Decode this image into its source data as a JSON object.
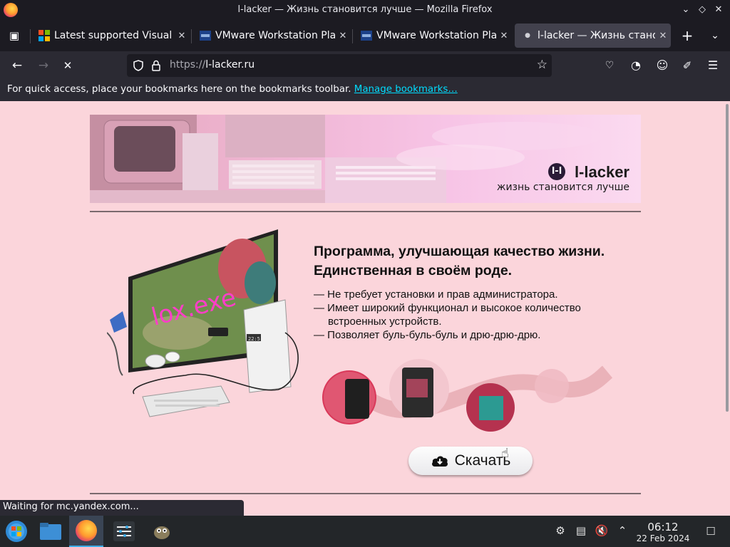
{
  "window": {
    "title": "l-lacker — Жизнь становится лучше — Mozilla Firefox"
  },
  "tabs": [
    {
      "label": "Latest supported Visual C",
      "favicon": "microsoft-icon"
    },
    {
      "label": "VMware Workstation Play",
      "favicon": "vmware-icon"
    },
    {
      "label": "VMware Workstation Play",
      "favicon": "vmware-icon"
    },
    {
      "label": "l-lacker — Жизнь станов",
      "favicon": "loading-dot-icon",
      "active": true
    }
  ],
  "urlbar": {
    "prefix": "https://",
    "host": "l-lacker.ru"
  },
  "bookmarks_bar": {
    "text": "For quick access, place your bookmarks here on the bookmarks toolbar.",
    "link": "Manage bookmarks…"
  },
  "page": {
    "banner": {
      "brand": "l-lacker",
      "tagline": "жизнь становится лучше",
      "logo_letters": "l-l"
    },
    "hero_screen_text": "lox.exe",
    "clock_display": "22:5",
    "heading_line1": "Программа, улучшающая качество жизни.",
    "heading_line2": "Единственная в своём роде.",
    "features": [
      "— Не требует установки и прав администратора.",
      "— Имеет широкий функционал и высокое количество",
      "встроенных устройств.",
      "— Позволяет буль-буль-буль и дрю-дрю-дрю."
    ],
    "download_button": "Скачать"
  },
  "status_bar": {
    "text": "Waiting for mc.yandex.com..."
  },
  "taskbar": {
    "time": "06:12",
    "date": "22 Feb 2024"
  },
  "colors": {
    "page_bg": "#fbd5db",
    "accent": "#3daee9",
    "link": "#00ddff"
  }
}
